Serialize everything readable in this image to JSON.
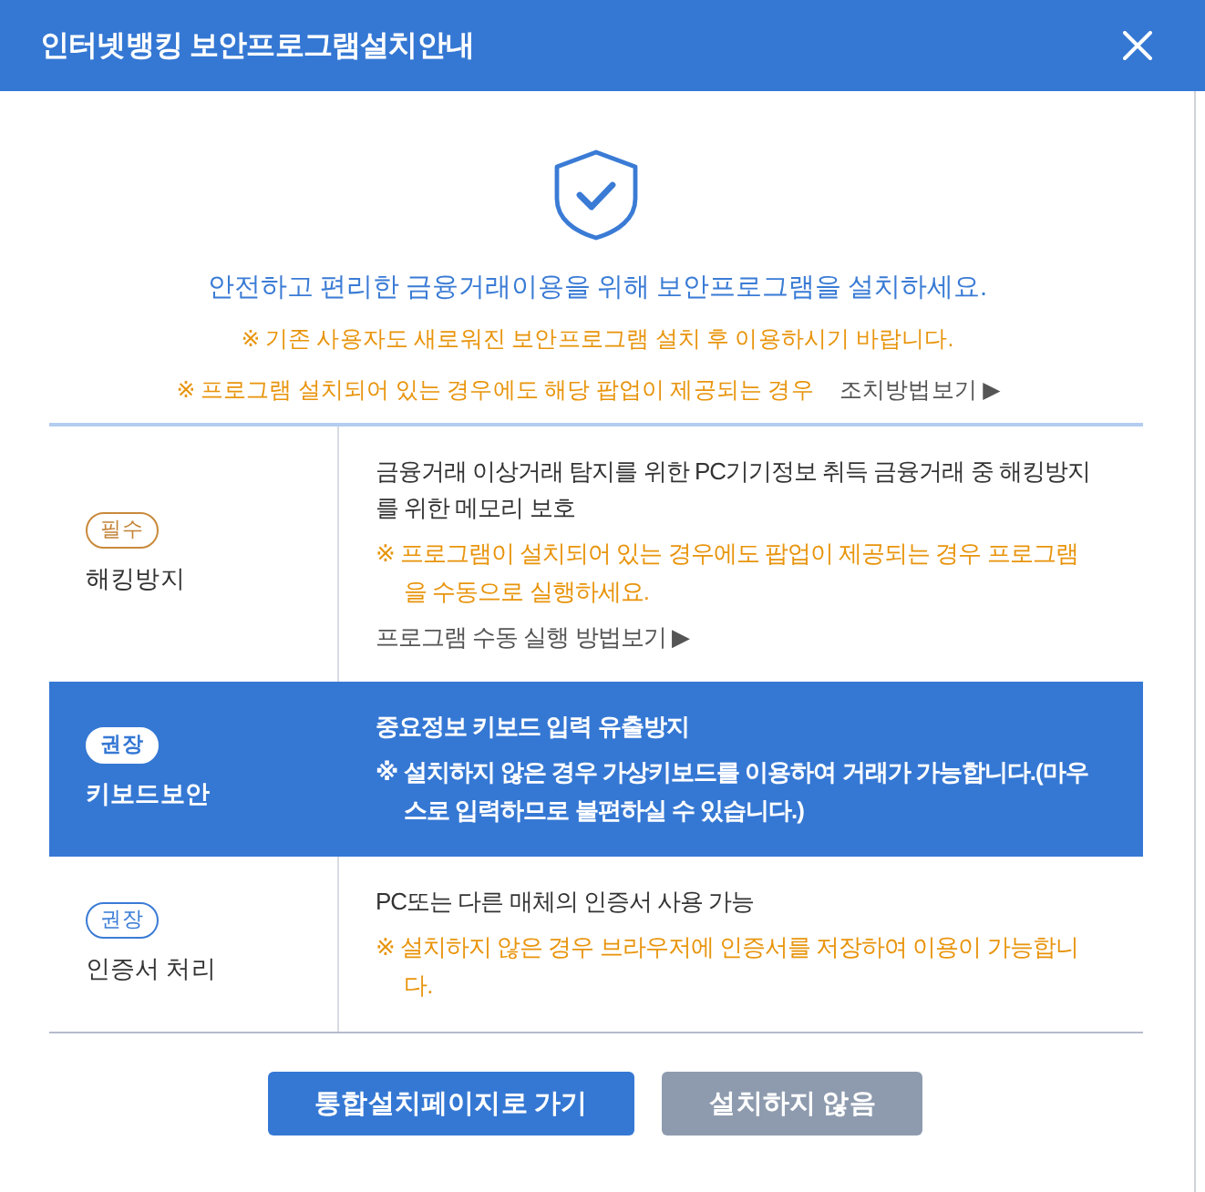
{
  "window": {
    "title": "인터넷뱅킹 보안프로그램설치안내"
  },
  "intro": {
    "headline": "안전하고 편리한 금융거래이용을 위해 보안프로그램을 설치하세요.",
    "notice": "※ 기존 사용자도 새로워진 보안프로그램 설치 후 이용하시기 바랍니다.",
    "popup_notice": "※ 프로그램 설치되어 있는 경우에도 해당 팝업이 제공되는 경우",
    "help_link": "조치방법보기 ▶"
  },
  "programs": [
    {
      "badge": {
        "label": "필수",
        "kind": "required"
      },
      "name": "해킹방지",
      "selected": false,
      "description": "금융거래 이상거래 탐지를 위한 PC기기정보 취득 금융거래 중 해킹방지를 위한 메모리 보호",
      "note": "※ 프로그램이 설치되어 있는 경우에도 팝업이 제공되는 경우 프로그램을 수동으로 실행하세요.",
      "link": "프로그램 수동 실행 방법보기 ▶"
    },
    {
      "badge": {
        "label": "권장",
        "kind": "recommended"
      },
      "name": "키보드보안",
      "selected": true,
      "description": "중요정보 키보드 입력 유출방지",
      "note": "※ 설치하지 않은 경우 가상키보드를 이용하여 거래가 가능합니다.(마우스로 입력하므로 불편하실 수 있습니다.)"
    },
    {
      "badge": {
        "label": "권장",
        "kind": "recommended"
      },
      "name": "인증서 처리",
      "selected": false,
      "description": "PC또는 다른 매체의 인증서 사용 가능",
      "note": "※ 설치하지 않은 경우 브라우저에 인증서를 저장하여 이용이 가능합니다."
    }
  ],
  "buttons": [
    {
      "label": "통합설치페이지로 가기",
      "kind": "primary"
    },
    {
      "label": "설치하지 않음",
      "kind": "secondary"
    }
  ]
}
